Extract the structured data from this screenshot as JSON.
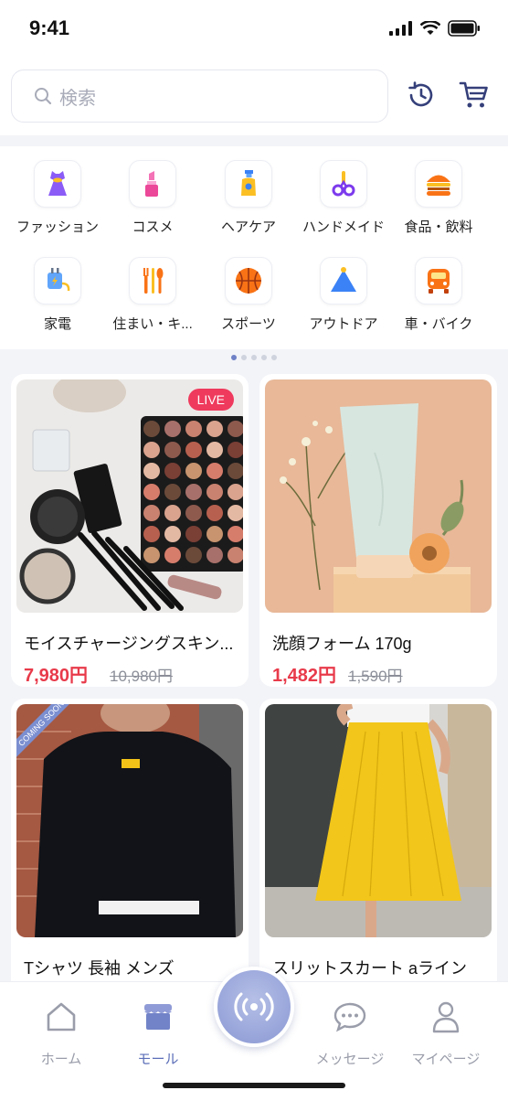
{
  "status": {
    "time": "9:41"
  },
  "search": {
    "placeholder": "検索"
  },
  "header_icons": [
    "history-icon",
    "cart-icon"
  ],
  "categories": [
    {
      "label": "ファッション",
      "icon": "dress-icon"
    },
    {
      "label": "コスメ",
      "icon": "lipstick-icon"
    },
    {
      "label": "ヘアケア",
      "icon": "shampoo-bottle-icon"
    },
    {
      "label": "ハンドメイド",
      "icon": "scissors-icon"
    },
    {
      "label": "食品・飲料",
      "icon": "burger-icon"
    },
    {
      "label": "家電",
      "icon": "plug-icon"
    },
    {
      "label": "住まい・キ...",
      "icon": "cutlery-icon"
    },
    {
      "label": "スポーツ",
      "icon": "basketball-icon"
    },
    {
      "label": "アウトドア",
      "icon": "tent-icon"
    },
    {
      "label": "車・バイク",
      "icon": "car-icon"
    }
  ],
  "pager": {
    "count": 5,
    "active": 0
  },
  "products": [
    {
      "name": "モイスチャージングスキン...",
      "price": "7,980円",
      "old_price": "10,980円",
      "badge": "LIVE"
    },
    {
      "name": "洗顔フォーム 170g",
      "price": "1,482円",
      "old_price": "1,590円",
      "badge": ""
    },
    {
      "name": "Tシャツ 長袖 メンズ",
      "price": "",
      "old_price": "",
      "badge": "COMING SOON"
    },
    {
      "name": "スリットスカート aライン",
      "price": "",
      "old_price": "",
      "badge": ""
    }
  ],
  "tabs": [
    {
      "label": "ホーム",
      "icon": "home-icon",
      "active": false
    },
    {
      "label": "モール",
      "icon": "shop-icon",
      "active": true
    },
    {
      "label": "メッセージ",
      "icon": "chat-icon",
      "active": false
    },
    {
      "label": "マイページ",
      "icon": "profile-icon",
      "active": false
    }
  ],
  "colors": {
    "accent": "#5c6fb8",
    "price": "#e83a4a",
    "live": "#ef3a5d"
  }
}
